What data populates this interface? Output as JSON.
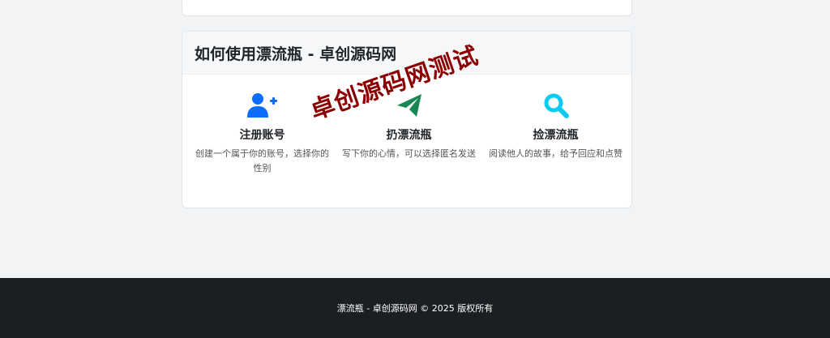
{
  "section": {
    "title": "如何使用漂流瓶 - 卓创源码网"
  },
  "features": [
    {
      "icon": "user-plus-icon",
      "title": "注册账号",
      "desc": "创建一个属于你的账号，选择你的性别",
      "color": "#0d6efd"
    },
    {
      "icon": "paper-plane-icon",
      "title": "扔漂流瓶",
      "desc": "写下你的心情，可以选择匿名发送",
      "color": "#198754"
    },
    {
      "icon": "search-icon",
      "title": "捡漂流瓶",
      "desc": "阅读他人的故事，给予回应和点赞",
      "color": "#0dcaf0"
    }
  ],
  "watermark": "卓创源码网测试",
  "footer": {
    "text": "漂流瓶 - 卓创源码网 © 2025 版权所有"
  }
}
